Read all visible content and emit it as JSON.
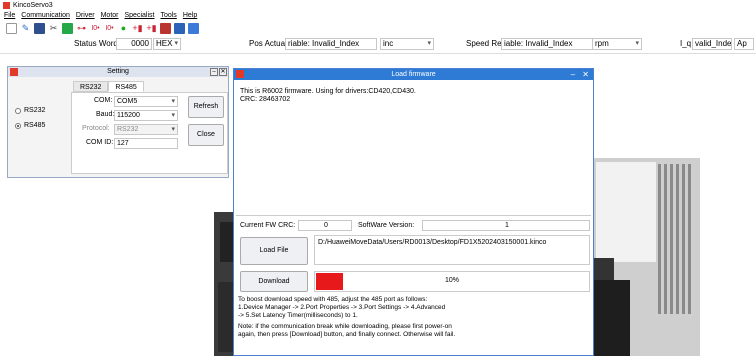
{
  "app": {
    "title": "KincoServo3"
  },
  "menu": [
    "File",
    "Communication",
    "Driver",
    "Motor",
    "Specialist",
    "Tools",
    "Help"
  ],
  "toolbar_icons": [
    "new-file-icon",
    "edit-icon",
    "save-icon",
    "connect-icon",
    "disconnect-icon",
    "link-icon",
    "io-icon",
    "io-out-icon",
    "status-dot-icon",
    "split-icon",
    "merge-icon",
    "monitor-icon",
    "window-icon",
    "chart-icon"
  ],
  "status": {
    "status_word_label": "Status Word",
    "status_word_value": "0000",
    "status_word_format": "HEX",
    "pos_actual_label": "Pos Actual",
    "pos_actual_value": "riable: Invalid_Index",
    "pos_actual_unit": "inc",
    "speed_real_label": "Speed Real",
    "speed_real_value": "iable: Invalid_Index",
    "speed_real_unit": "rpm",
    "iq_label": "I_q",
    "iq_value": "valid_Index",
    "iq_unit": "Ap"
  },
  "setting": {
    "title": "Setting",
    "tabs": [
      "RS232",
      "RS485"
    ],
    "active_tab": "RS485",
    "radio_rs232": "RS232",
    "radio_rs485": "RS485",
    "com_label": "COM:",
    "com_value": "COM5",
    "baud_label": "Baud:",
    "baud_value": "115200",
    "protocol_label": "Protocol:",
    "protocol_value": "RS232",
    "comid_label": "COM ID:",
    "comid_value": "127",
    "refresh_label": "Refresh",
    "close_label": "Close"
  },
  "load_firmware": {
    "title": "Load firmware",
    "info_line1": "This is R6002 firmware. Using for drivers:CD420,CD430.",
    "info_line2": "CRC: 28463702",
    "current_crc_label": "Current FW CRC:",
    "current_crc_value": "0",
    "software_version_label": "SoftWare Version:",
    "software_version_value": "1",
    "load_file_label": "Load File",
    "file_path": "D:/HuaweiMoveData/Users/RD0013/Desktop/FD1X5202403150001.kinco",
    "download_label": "Download",
    "progress_percent": 10,
    "progress_text": "10%",
    "note1": "To boost download speed with 485, adjust the 485 port as follows:",
    "note2": "1.Device Manager -> 2.Port Properties -> 3.Port Settings -> 4.Advanced",
    "note3": "-> 5.Set Latency Timer(milliseconds) to 1.",
    "note4": "Note: if the communication break while downloading, please first power-on",
    "note5": "again, then press [Download] button, and finally connect. Otherwise will fail."
  },
  "colors": {
    "accent": "#2e7bd6",
    "progress": "#e8191a",
    "brand": "#e23a2a"
  }
}
